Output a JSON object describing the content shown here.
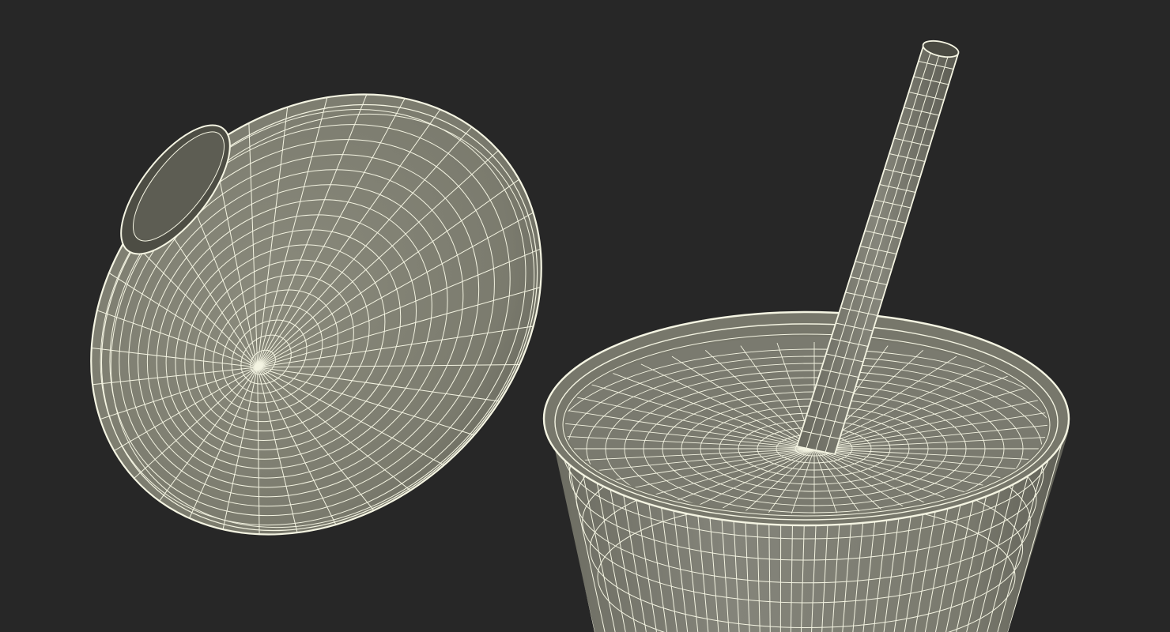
{
  "scene": {
    "background": "#272727",
    "surface_color": "#7f7f72",
    "surface_dark_color": "#5c5c52",
    "wire_color": "#f4f4e2",
    "objects": [
      "dome-lid-wireframe",
      "cup-wireframe",
      "straw-wireframe"
    ]
  }
}
